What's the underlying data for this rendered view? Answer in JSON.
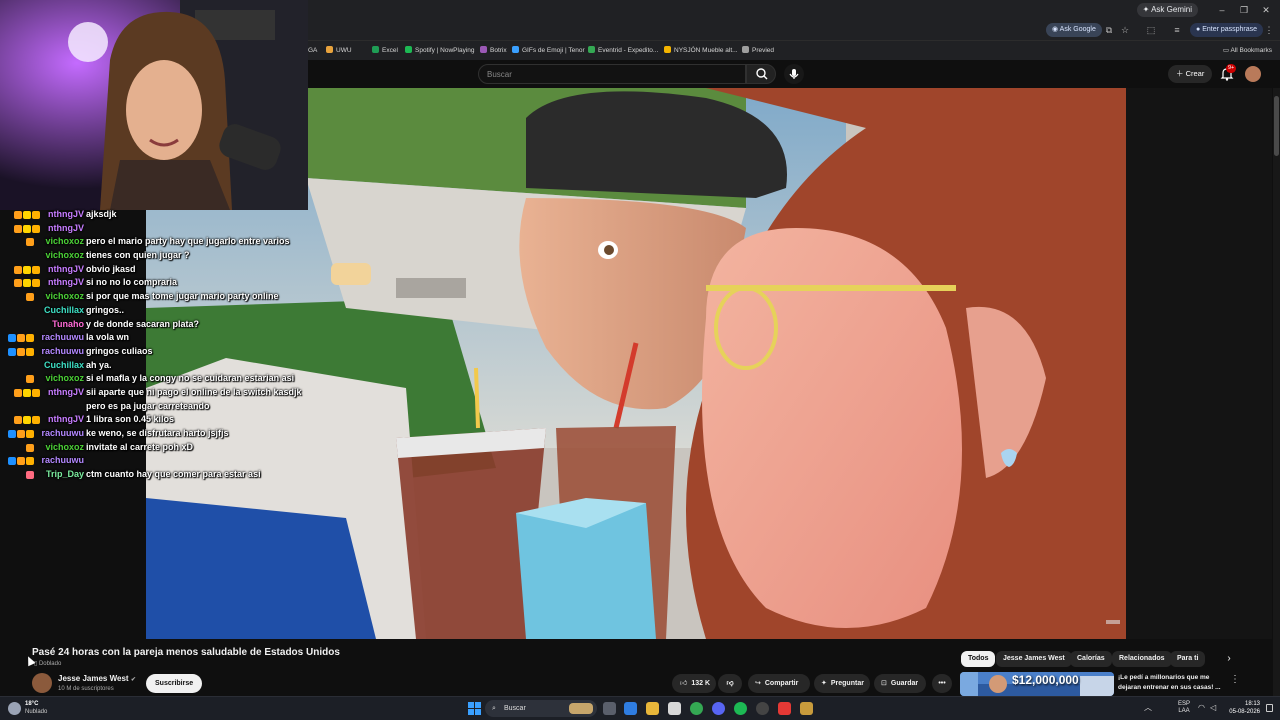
{
  "browser": {
    "gemini_label": "Ask Gemini",
    "ask_google_label": "Ask Google",
    "passphrase_label": "Enter passphrase",
    "bookmarks": [
      {
        "label": "GA",
        "color": "#4285f4"
      },
      {
        "label": "UWU",
        "color": "#e8a33d"
      },
      {
        "label": "Excel",
        "color": "#1f9d55"
      },
      {
        "label": "Spotify | NowPlaying",
        "color": "#1db954"
      },
      {
        "label": "Botrix",
        "color": "#9b59b6"
      },
      {
        "label": "GIFs de Emoji | Tenor",
        "color": "#3aa0ff"
      },
      {
        "label": "Eventrid - Expedito...",
        "color": "#34a853"
      },
      {
        "label": "NYSJÓN Mueble alt...",
        "color": "#f4b400"
      },
      {
        "label": "Previed",
        "color": "#9e9e9e"
      }
    ],
    "all_bookmarks_label": "All Bookmarks"
  },
  "masthead": {
    "search_placeholder": "Buscar",
    "create_label": "Crear",
    "notifications_count": "9+"
  },
  "chat": {
    "messages": [
      {
        "user": "nthngJV",
        "color": "#c77dff",
        "text": "ajksdjk",
        "badges": [
          "#ff9f1a",
          "#ffd500",
          "#ffb100"
        ]
      },
      {
        "user": "nthngJV",
        "color": "#c77dff",
        "text": "",
        "badges": [
          "#ff9f1a",
          "#ffd500",
          "#ffb100"
        ]
      },
      {
        "user": "vichoxoz",
        "color": "#4cd137",
        "text": "pero el mario party hay que jugarlo entre varios",
        "badges": [
          "#ff9f1a"
        ]
      },
      {
        "user": "vichoxoz",
        "color": "#4cd137",
        "text": "tienes con quien jugar ?",
        "badges": []
      },
      {
        "user": "nthngJV",
        "color": "#c77dff",
        "text": "obvio jkasd",
        "badges": [
          "#ff9f1a",
          "#ffd500",
          "#ffb100"
        ]
      },
      {
        "user": "nthngJV",
        "color": "#c77dff",
        "text": "si no no lo compraria",
        "badges": [
          "#ff9f1a",
          "#ffd500",
          "#ffb100"
        ]
      },
      {
        "user": "vichoxoz",
        "color": "#4cd137",
        "text": "si por que mas tome jugar mario party online",
        "badges": [
          "#ff9f1a"
        ]
      },
      {
        "user": "Cuchillax",
        "color": "#3ee0c5",
        "text": "gringos..",
        "badges": []
      },
      {
        "user": "Tunaho",
        "color": "#ff6bd6",
        "text": "y de donde sacaran plata?",
        "badges": []
      },
      {
        "user": "rachuuwu",
        "color": "#b388ff",
        "text": "la vola wn",
        "badges": [
          "#1e90ff",
          "#ff9f1a",
          "#ffb100"
        ]
      },
      {
        "user": "rachuuwu",
        "color": "#b388ff",
        "text": "gringos culiaos",
        "badges": [
          "#1e90ff",
          "#ff9f1a",
          "#ffb100"
        ]
      },
      {
        "user": "Cuchillax",
        "color": "#3ee0c5",
        "text": "ah ya.",
        "badges": []
      },
      {
        "user": "vichoxoz",
        "color": "#4cd137",
        "text": "si el mafla y la congy no se cuidaran estarian asi",
        "badges": [
          "#ff9f1a"
        ]
      },
      {
        "user": "nthngJV",
        "color": "#c77dff",
        "text": "sii aparte que ni pago el online de la switch kasdjk",
        "badges": [
          "#ff9f1a",
          "#ffd500",
          "#ffb100"
        ]
      },
      {
        "user": "",
        "color": "#c77dff",
        "text": "pero es pa jugar carreteando",
        "badges": []
      },
      {
        "user": "nthngJV",
        "color": "#c77dff",
        "text": "1 libra son 0.45 kilos",
        "badges": [
          "#ff9f1a",
          "#ffd500",
          "#ffb100"
        ]
      },
      {
        "user": "rachuuwu",
        "color": "#b388ff",
        "text": "ke weno, se disfrutara harto jsjfjs",
        "badges": [
          "#1e90ff",
          "#ff9f1a",
          "#ffb100"
        ]
      },
      {
        "user": "vichoxoz",
        "color": "#4cd137",
        "text": "invitate al carrete poh xD",
        "badges": [
          "#ff9f1a"
        ]
      },
      {
        "user": "rachuuwu",
        "color": "#b388ff",
        "text": "",
        "badges": [
          "#1e90ff",
          "#ff9f1a",
          "#ffb100"
        ]
      },
      {
        "user": "Trip_Day",
        "color": "#7bed9f",
        "text": "ctm cuanto hay que comer para estar asi",
        "badges": [
          "#ff6b81"
        ]
      }
    ]
  },
  "video": {
    "title": "Pasé 24 horas con la pareja menos saludable de Estados Unidos",
    "dubbed_label": "Doblado",
    "channel_name": "Jesse James West",
    "subscribers": "10 M de suscriptores",
    "subscribe_label": "Suscribirse",
    "likes": "132 K",
    "share_label": "Compartir",
    "ask_label": "Preguntar",
    "save_label": "Guardar"
  },
  "chips": [
    {
      "label": "Todos",
      "active": true
    },
    {
      "label": "Jesse James West",
      "active": false
    },
    {
      "label": "Calorías",
      "active": false
    },
    {
      "label": "Relacionados",
      "active": false
    },
    {
      "label": "Para ti",
      "active": false
    }
  ],
  "recommendation": {
    "thumb_text": "$12,000,000",
    "title": "¡Le pedí a millonarios que me dejaran entrenar en sus casas! ..."
  },
  "taskbar": {
    "weather_temp": "18°C",
    "weather_desc": "Nublado",
    "search_label": "Buscar",
    "lang_top": "ESP",
    "lang_bottom": "LAA",
    "time": "18:13",
    "date": "05-08-2026"
  },
  "colors": {
    "youtube_dark": "#0f0f0f",
    "chip_bg": "#272727",
    "subscribe_bg": "#f1f1f1",
    "notification_red": "#cc0000"
  }
}
